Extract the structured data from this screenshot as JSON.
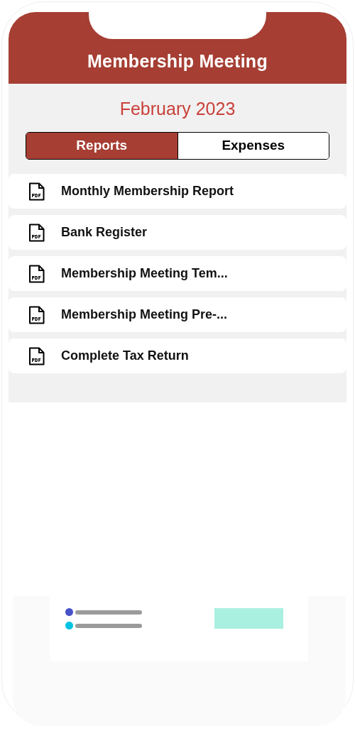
{
  "header": {
    "title": "Membership Meeting"
  },
  "period": "February 2023",
  "tabs": [
    {
      "label": "Reports",
      "selected": true
    },
    {
      "label": "Expenses",
      "selected": false
    }
  ],
  "documents": [
    {
      "name": "Monthly Membership Report"
    },
    {
      "name": "Bank Register"
    },
    {
      "name": "Membership Meeting Tem..."
    },
    {
      "name": "Membership Meeting Pre-..."
    },
    {
      "name": "Complete Tax Return"
    }
  ],
  "preview_card": {
    "rows": [
      {
        "color": "#4652c8"
      },
      {
        "color": "#00c3e3"
      }
    ]
  }
}
